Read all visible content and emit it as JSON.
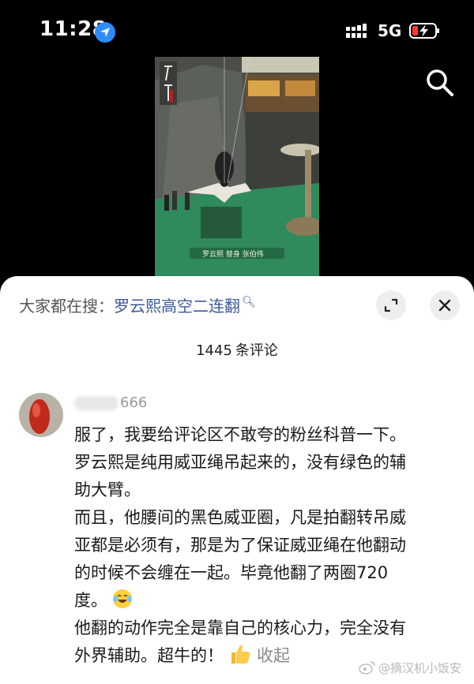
{
  "status_bar": {
    "time": "11:28",
    "network": "5G"
  },
  "video": {
    "subtitle_label": "罗云熙 替身 张伯伟"
  },
  "sheet": {
    "search_prefix": "大家都在搜：",
    "search_term": "罗云熙高空二连翻",
    "comment_count": "1445",
    "comment_count_label": "条评论"
  },
  "comment": {
    "username": "666",
    "lines": [
      "服了，我要给评论区不敢夸的粉丝科普一下。",
      "罗云熙是纯用威亚绳吊起来的，没有绿色的辅",
      "助大臂。",
      "而且，他腰间的黑色威亚圈，凡是拍翻转吊威",
      "亚都是必须有，那是为了保证威亚绳在他翻动",
      "的时候不会缠在一起。毕竟他翻了两圈720",
      "度。",
      "他翻的动作完全是靠自己的核心力，完全没有",
      "外界辅助。超牛的！"
    ],
    "collapse_label": "收起"
  },
  "watermark": "@摘汉机小饭安",
  "colors": {
    "link_blue": "#3a5a99",
    "location_blue": "#2f8cff",
    "battery_red": "#ff3b30"
  }
}
